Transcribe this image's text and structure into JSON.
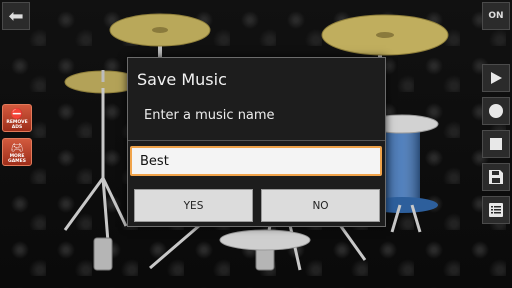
{
  "top_bar": {
    "back_icon": "left-arrow-icon",
    "on_label": "ON"
  },
  "left_toolbar": [
    {
      "label": "REMOVE ADS",
      "icon": "remove-ads-icon"
    },
    {
      "label": "MORE GAMES",
      "icon": "gamepad-icon"
    }
  ],
  "right_toolbar": [
    {
      "icon": "play-icon"
    },
    {
      "icon": "record-icon"
    },
    {
      "icon": "stop-icon"
    },
    {
      "icon": "save-icon"
    },
    {
      "icon": "list-icon"
    }
  ],
  "dialog": {
    "title": "Save Music",
    "message": "Enter a music name",
    "input_value": "Best",
    "yes_label": "YES",
    "no_label": "NO",
    "accent_color": "#f0a34a"
  }
}
